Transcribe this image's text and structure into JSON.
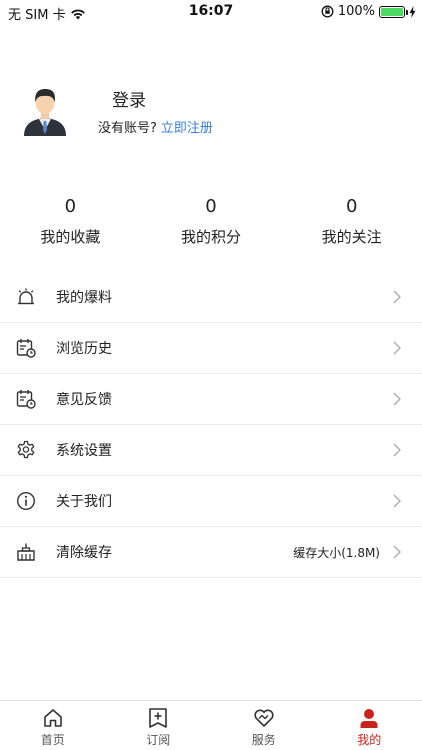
{
  "status_bar": {
    "carrier": "无 SIM 卡",
    "time": "16:07",
    "battery_percent": "100%",
    "battery_level": 1.0,
    "battery_color": "#4cd964"
  },
  "profile": {
    "login_title": "登录",
    "no_account_text": "没有账号?",
    "register_link": "立即注册"
  },
  "stats": [
    {
      "value": "0",
      "label": "我的收藏"
    },
    {
      "value": "0",
      "label": "我的积分"
    },
    {
      "value": "0",
      "label": "我的关注"
    }
  ],
  "menu": {
    "items": [
      {
        "label": "我的爆料",
        "icon": "alarm-icon"
      },
      {
        "label": "浏览历史",
        "icon": "calendar-clock-icon"
      },
      {
        "label": "意见反馈",
        "icon": "calendar-clock-icon"
      },
      {
        "label": "系统设置",
        "icon": "gear-icon"
      },
      {
        "label": "关于我们",
        "icon": "info-icon"
      },
      {
        "label": "清除缓存",
        "icon": "basket-icon",
        "extra": "缓存大小(1.8M)"
      }
    ]
  },
  "tab_bar": {
    "tabs": [
      {
        "label": "首页",
        "icon": "home-icon"
      },
      {
        "label": "订阅",
        "icon": "subscribe-icon"
      },
      {
        "label": "服务",
        "icon": "heart-hands-icon"
      },
      {
        "label": "我的",
        "icon": "person-icon",
        "active": true
      }
    ],
    "active_color": "#c8231f"
  },
  "colors": {
    "link": "#3a7fd5",
    "accent": "#c8231f"
  }
}
